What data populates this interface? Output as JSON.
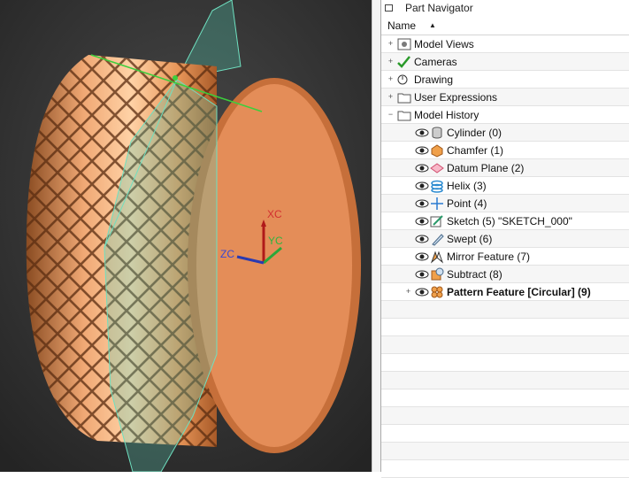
{
  "viewport": {
    "axes": {
      "xc": "XC",
      "yc": "YC",
      "zc": "ZC"
    },
    "colors": {
      "background": "#3a3a3a",
      "part": "#e8935e",
      "datum_plane": "#58c8b0"
    }
  },
  "navigator": {
    "title": "Part Navigator",
    "column_header": "Name",
    "groups": [
      {
        "label": "Model Views",
        "icon": "model-views-icon"
      },
      {
        "label": "Cameras",
        "icon": "camera-icon"
      },
      {
        "label": "Drawing",
        "icon": "drawing-icon"
      },
      {
        "label": "User Expressions",
        "icon": "folder-icon"
      },
      {
        "label": "Model History",
        "icon": "folder-icon"
      }
    ],
    "features": [
      {
        "label": "Cylinder (0)",
        "icon": "cylinder-icon"
      },
      {
        "label": "Chamfer (1)",
        "icon": "chamfer-icon"
      },
      {
        "label": "Datum Plane (2)",
        "icon": "datum-plane-icon"
      },
      {
        "label": "Helix (3)",
        "icon": "helix-icon"
      },
      {
        "label": "Point (4)",
        "icon": "point-icon"
      },
      {
        "label": "Sketch (5) \"SKETCH_000\"",
        "icon": "sketch-icon"
      },
      {
        "label": "Swept (6)",
        "icon": "swept-icon"
      },
      {
        "label": "Mirror Feature (7)",
        "icon": "mirror-icon"
      },
      {
        "label": "Subtract (8)",
        "icon": "subtract-icon"
      },
      {
        "label": "Pattern Feature [Circular] (9)",
        "icon": "pattern-icon"
      }
    ]
  }
}
